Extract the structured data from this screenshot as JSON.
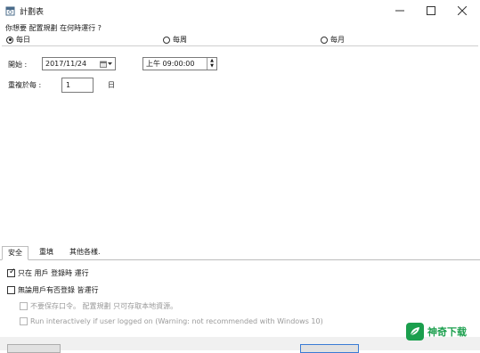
{
  "window": {
    "title": "計劃表"
  },
  "prompt": "你想要 配置規劃 在何時運行 ?",
  "frequency": {
    "options": [
      "每日",
      "每周",
      "每月"
    ],
    "selected": "每日"
  },
  "schedule": {
    "start_label": "開始 :",
    "start_date": "2017/11/24",
    "start_time": "上午 09:00:00",
    "repeat_label": "重複於每 :",
    "repeat_value": "1",
    "repeat_unit": "日"
  },
  "tabs": [
    "安全",
    "重填",
    "其他各樣."
  ],
  "active_tab": "安全",
  "security": {
    "only_when_logged_on": {
      "label": "只在 用戶 登錄時 運行",
      "checked": true
    },
    "regardless_logged_on": {
      "label": "無論用戶有否登錄 皆運行",
      "checked": false
    },
    "no_store_password": {
      "label": "不要保存口令。 配置規劃 只可存取本地資源。",
      "checked": false,
      "enabled": false
    },
    "run_interactively": {
      "label": "Run interactively if user logged on (Warning: not recommended with Windows 10)",
      "checked": false,
      "enabled": false
    }
  },
  "watermark": {
    "text": "神奇下载",
    "color": "#1b9f4d"
  },
  "icons": {
    "app": "calendar-icon",
    "minimize": "minimize-icon",
    "maximize": "maximize-icon",
    "close": "close-icon"
  }
}
